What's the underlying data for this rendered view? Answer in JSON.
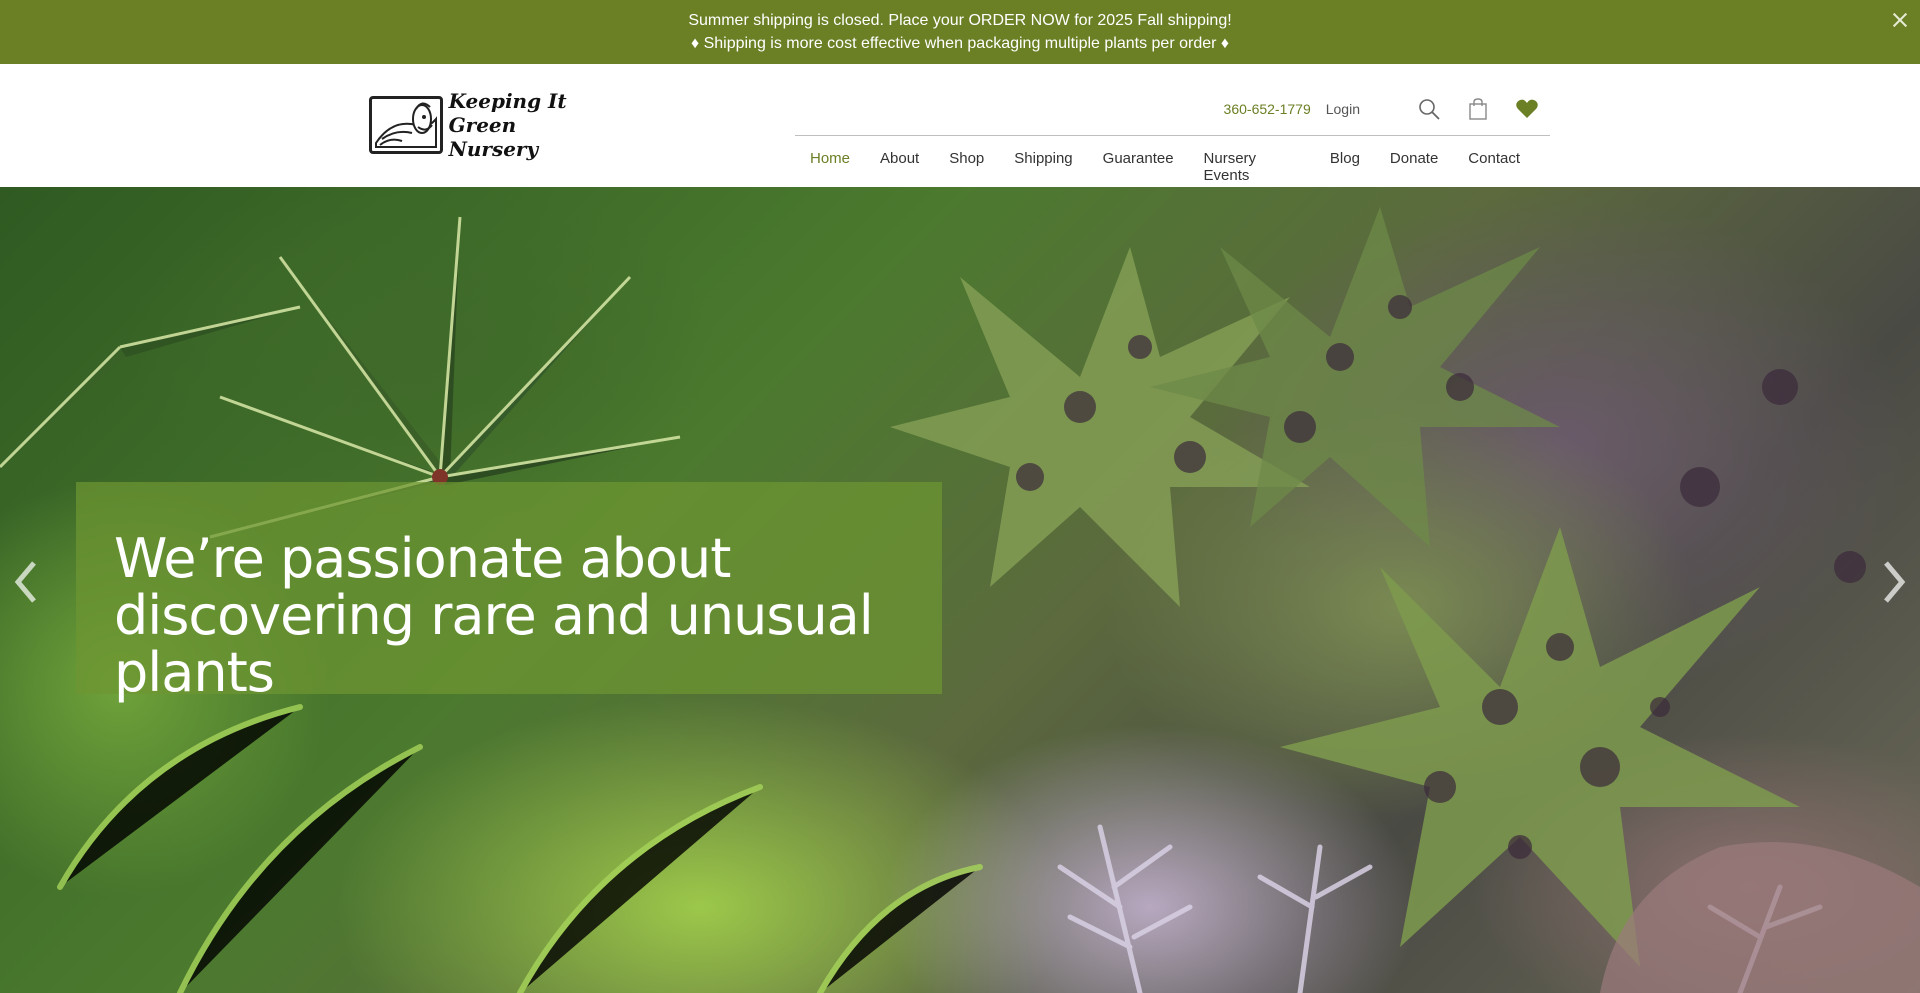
{
  "announcement": {
    "line1": "Summer shipping is closed. Place your ORDER NOW for 2025 Fall shipping!",
    "line2": "♦ Shipping is more cost effective when packaging multiple plants per order ♦"
  },
  "logo": {
    "line1": "Keeping It",
    "line2": "Green Nursery"
  },
  "utility": {
    "phone": "360-652-1779",
    "login": "Login"
  },
  "nav": [
    {
      "label": "Home"
    },
    {
      "label": "About"
    },
    {
      "label": "Shop"
    },
    {
      "label": "Shipping"
    },
    {
      "label": "Guarantee"
    },
    {
      "label": "Nursery Events"
    },
    {
      "label": "Blog"
    },
    {
      "label": "Donate"
    },
    {
      "label": "Contact"
    }
  ],
  "hero": {
    "headline": "We’re passionate about discovering rare and unusual plants"
  },
  "colors": {
    "brand_green": "#6b7f25",
    "caption_overlay": "rgba(110,150,50,0.72)"
  },
  "icons": [
    "close-icon",
    "search-icon",
    "shopping-bag-icon",
    "heart-icon",
    "chevron-left-icon",
    "chevron-right-icon"
  ]
}
